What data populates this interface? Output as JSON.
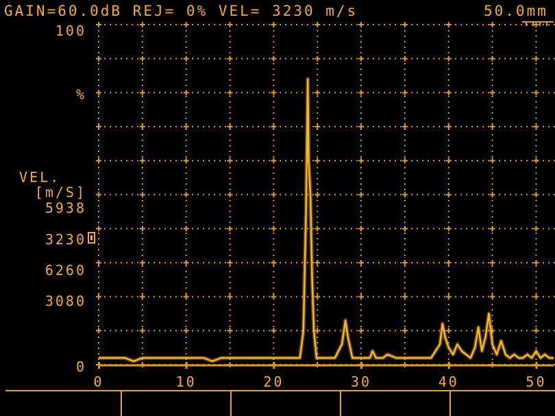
{
  "header": {
    "status_line": "GAIN=60.0dB REJ= 0% VEL= 3230 m/s",
    "range": "50.0mm"
  },
  "y_axis": {
    "top_label": "100",
    "unit_label": "%",
    "zero_label": "0"
  },
  "velocity_panel": {
    "title": "VEL.",
    "unit": "[m/S]",
    "values": [
      "5938",
      "3230",
      "6260",
      "3080"
    ],
    "selected_index": 1
  },
  "colors": {
    "trace": "#f7b531",
    "grid": "#e39a1a",
    "text": "#f7ae2a",
    "background": "#000000"
  },
  "chart_data": {
    "type": "line",
    "xlabel": "",
    "ylabel": "%",
    "xlim": [
      0,
      52
    ],
    "ylim": [
      0,
      100
    ],
    "grid": true,
    "x_ticks": [
      0,
      10,
      20,
      30,
      40,
      50
    ],
    "x": [
      0,
      1,
      2,
      3,
      4,
      5,
      6,
      7,
      8,
      9,
      10,
      11,
      12,
      13,
      14,
      15,
      16,
      17,
      18,
      19,
      20,
      21,
      22,
      23,
      23.4,
      23.7,
      23.9,
      24.0,
      24.2,
      24.4,
      24.6,
      24.9,
      25.3,
      26,
      27,
      27.8,
      28.2,
      28.5,
      29,
      29.6,
      30,
      31,
      31.3,
      31.7,
      32.5,
      33,
      34,
      35,
      36,
      37,
      38,
      38.5,
      39,
      39.3,
      39.6,
      40,
      40.5,
      41,
      41.5,
      42,
      42.5,
      43,
      43.4,
      43.8,
      44.2,
      44.6,
      45,
      45.5,
      46,
      46.5,
      47,
      47.5,
      48,
      48.5,
      49,
      49.5,
      50,
      50.5,
      51,
      51.5,
      52
    ],
    "values": [
      2,
      2,
      2,
      2,
      1,
      2,
      2,
      2,
      2,
      2,
      2,
      2,
      2,
      1,
      2,
      2,
      2,
      2,
      2,
      2,
      2,
      2,
      2,
      2,
      10,
      45,
      84,
      60,
      50,
      25,
      10,
      2,
      2,
      2,
      2,
      6,
      13,
      8,
      2,
      2,
      2,
      2,
      4,
      2,
      2,
      3,
      2,
      2,
      2,
      2,
      2,
      4,
      6,
      12,
      8,
      5,
      3,
      6,
      4,
      3,
      2,
      5,
      11,
      4,
      8,
      15,
      6,
      3,
      7,
      3,
      2,
      3,
      2,
      2,
      3,
      2,
      4,
      2,
      3,
      2,
      2
    ]
  }
}
